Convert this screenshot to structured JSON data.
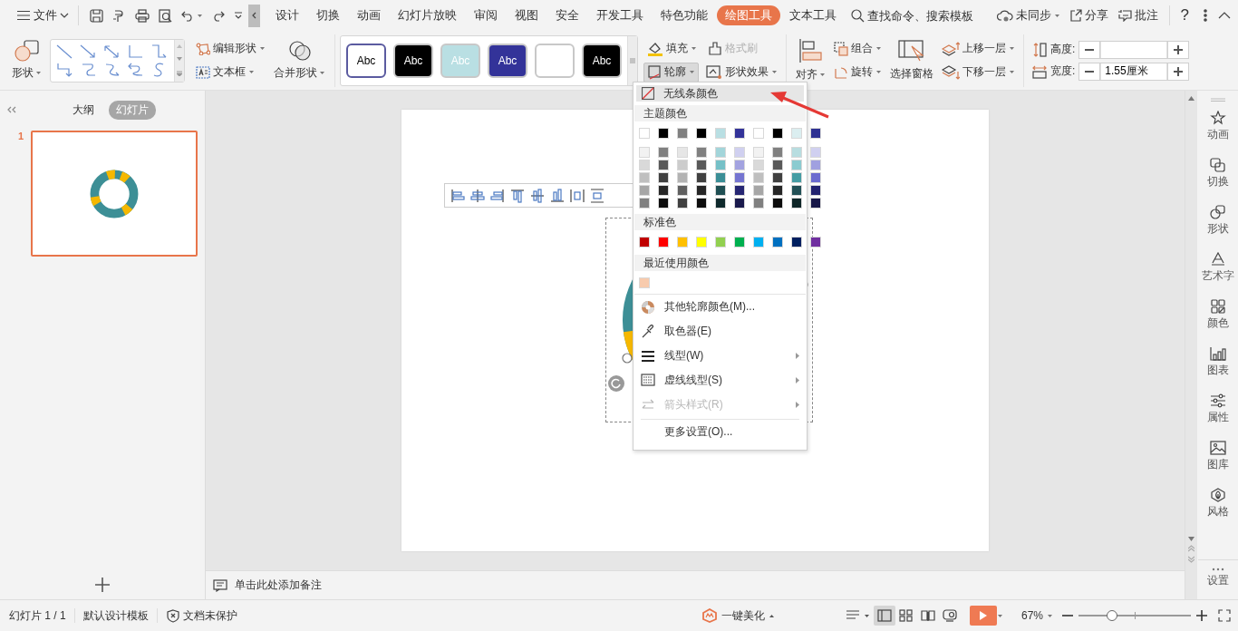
{
  "menubar": {
    "file_menu": "文件",
    "tabs": [
      {
        "label": "设计",
        "selected": false
      },
      {
        "label": "切换",
        "selected": false
      },
      {
        "label": "动画",
        "selected": false
      },
      {
        "label": "幻灯片放映",
        "selected": false
      },
      {
        "label": "审阅",
        "selected": false
      },
      {
        "label": "视图",
        "selected": false
      },
      {
        "label": "安全",
        "selected": false
      },
      {
        "label": "开发工具",
        "selected": false
      },
      {
        "label": "特色功能",
        "selected": false
      },
      {
        "label": "绘图工具",
        "selected": true
      },
      {
        "label": "文本工具",
        "selected": false
      }
    ],
    "search": {
      "placeholder": "查找命令、搜索模板"
    },
    "sync": "未同步",
    "share": "分享",
    "comment": "批注",
    "help": "?"
  },
  "ribbon": {
    "shape": "形状",
    "edit_shape": "编辑形状",
    "text_box": "文本框",
    "merge_shape": "合并形状",
    "styles": [
      {
        "label": "Abc",
        "color": "#ffffff"
      },
      {
        "label": "Abc",
        "color": "#000000"
      },
      {
        "label": "Abc",
        "color": "#b9dfe3"
      },
      {
        "label": "Abc",
        "color": "#333399"
      },
      {
        "color": "#ffffff"
      },
      {
        "label": "Abc",
        "color": "#000000"
      }
    ],
    "fill": "填充",
    "format_painter": {
      "label": "格式刷",
      "disabled": true
    },
    "outline": {
      "label": "轮廓",
      "expanded": true
    },
    "shape_effects": "形状效果",
    "align": "对齐",
    "group": "组合",
    "rotate": "旋转",
    "selection_pane": "选择窗格",
    "bring_forward": "上移一层",
    "send_backward": "下移一层",
    "height": {
      "label": "高度:"
    },
    "width": {
      "label": "宽度:",
      "value": "1.55厘米"
    }
  },
  "side_panel": {
    "tabs": [
      {
        "label": "大纲",
        "selected": false
      },
      {
        "label": "幻灯片",
        "selected": true
      }
    ],
    "slides": [
      {
        "number": "1",
        "selected": true
      }
    ]
  },
  "notes": {
    "placeholder": "单击此处添加备注"
  },
  "outline_menu": {
    "no_line": {
      "label": "无线条颜色",
      "selected": true
    },
    "theme_header": "主题颜色",
    "theme_colors": [
      {
        "color": "#ffffff"
      },
      {
        "color": "#000000"
      },
      {
        "color": "#808080"
      },
      {
        "color": "#000000"
      },
      {
        "color": "#b9dfe3"
      },
      {
        "color": "#333399"
      },
      {
        "color": "#ffffff"
      },
      {
        "color": "#000000"
      },
      {
        "color": "#dbeef0"
      },
      {
        "color": "#2e3192"
      }
    ],
    "theme_shades": [
      [
        {
          "color": "#f2f2f2"
        },
        {
          "color": "#d9d9d9"
        },
        {
          "color": "#bfbfbf"
        },
        {
          "color": "#a6a6a6"
        },
        {
          "color": "#808080"
        }
      ],
      [
        {
          "color": "#808080"
        },
        {
          "color": "#595959"
        },
        {
          "color": "#404040"
        },
        {
          "color": "#262626"
        },
        {
          "color": "#0d0d0d"
        }
      ],
      [
        {
          "color": "#e6e6e6"
        },
        {
          "color": "#cccccc"
        },
        {
          "color": "#b3b3b3"
        },
        {
          "color": "#606060"
        },
        {
          "color": "#404040"
        }
      ],
      [
        {
          "color": "#808080"
        },
        {
          "color": "#595959"
        },
        {
          "color": "#404040"
        },
        {
          "color": "#262626"
        },
        {
          "color": "#0d0d0d"
        }
      ],
      [
        {
          "color": "#a3d5da"
        },
        {
          "color": "#75c0c7"
        },
        {
          "color": "#3b8e96"
        },
        {
          "color": "#1f4f53"
        },
        {
          "color": "#0f2a2c"
        }
      ],
      [
        {
          "color": "#d0d0f0"
        },
        {
          "color": "#a3a3e0"
        },
        {
          "color": "#7575d1"
        },
        {
          "color": "#262673"
        },
        {
          "color": "#1a1a4d"
        }
      ],
      [
        {
          "color": "#f2f2f2"
        },
        {
          "color": "#d9d9d9"
        },
        {
          "color": "#bfbfbf"
        },
        {
          "color": "#a6a6a6"
        },
        {
          "color": "#808080"
        }
      ],
      [
        {
          "color": "#808080"
        },
        {
          "color": "#595959"
        },
        {
          "color": "#404040"
        },
        {
          "color": "#262626"
        },
        {
          "color": "#0d0d0d"
        }
      ],
      [
        {
          "color": "#b8dde0"
        },
        {
          "color": "#8bcbd0"
        },
        {
          "color": "#459ca3"
        },
        {
          "color": "#225056"
        },
        {
          "color": "#0f2628"
        }
      ],
      [
        {
          "color": "#d0d0f0"
        },
        {
          "color": "#a0a0e0"
        },
        {
          "color": "#6b6bcf"
        },
        {
          "color": "#232370"
        },
        {
          "color": "#171748"
        }
      ]
    ],
    "standard_header": "标准色",
    "standard_colors": [
      {
        "color": "#c00000"
      },
      {
        "color": "#ff0000"
      },
      {
        "color": "#ffc000"
      },
      {
        "color": "#ffff00"
      },
      {
        "color": "#92d050"
      },
      {
        "color": "#00b050"
      },
      {
        "color": "#00b0f0"
      },
      {
        "color": "#0070c0"
      },
      {
        "color": "#002060"
      },
      {
        "color": "#7030a0"
      }
    ],
    "recent_header": "最近使用颜色",
    "recent_colors": [
      {
        "color": "#f8cbad"
      }
    ],
    "items": [
      {
        "label": "其他轮廓颜色(M)...",
        "disabled": false,
        "submenu": false
      },
      {
        "label": "取色器(E)",
        "disabled": false,
        "submenu": false
      },
      {
        "label": "线型(W)",
        "disabled": false,
        "submenu": true
      },
      {
        "label": "虚线线型(S)",
        "disabled": false,
        "submenu": true
      },
      {
        "label": "箭头样式(R)",
        "disabled": true,
        "submenu": true
      },
      {
        "label": "更多设置(O)...",
        "disabled": false,
        "submenu": false
      }
    ]
  },
  "right_sidebar": {
    "items": [
      {
        "label": "动画"
      },
      {
        "label": "切换"
      },
      {
        "label": "形状"
      },
      {
        "label": "艺术字"
      },
      {
        "label": "颜色"
      },
      {
        "label": "图表"
      },
      {
        "label": "属性"
      },
      {
        "label": "图库"
      },
      {
        "label": "风格"
      }
    ],
    "settings": "设置"
  },
  "status_bar": {
    "slide_count": "幻灯片 1 / 1",
    "template": "默认设计模板",
    "protection": "文档未保护",
    "beautify": "一键美化",
    "views": [
      {
        "selected": true
      },
      {
        "selected": false
      },
      {
        "selected": false
      },
      {
        "selected": false
      }
    ],
    "zoom": {
      "reading": "67%",
      "level": 0.3
    }
  }
}
